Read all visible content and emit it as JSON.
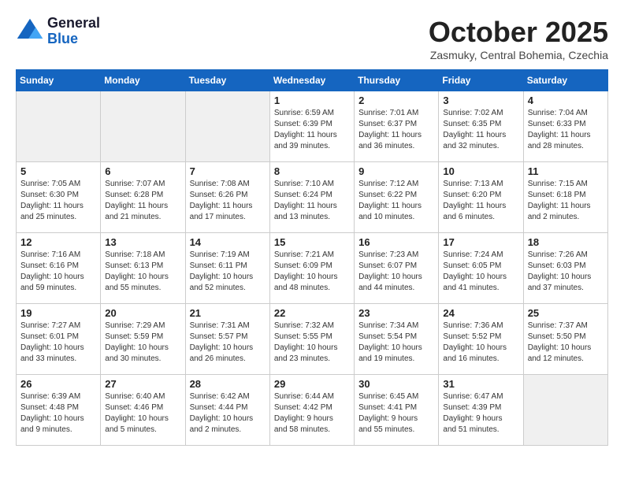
{
  "header": {
    "logo_line1": "General",
    "logo_line2": "Blue",
    "month": "October 2025",
    "location": "Zasmuky, Central Bohemia, Czechia"
  },
  "days_of_week": [
    "Sunday",
    "Monday",
    "Tuesday",
    "Wednesday",
    "Thursday",
    "Friday",
    "Saturday"
  ],
  "weeks": [
    [
      {
        "day": null,
        "text": null
      },
      {
        "day": null,
        "text": null
      },
      {
        "day": null,
        "text": null
      },
      {
        "day": "1",
        "text": "Sunrise: 6:59 AM\nSunset: 6:39 PM\nDaylight: 11 hours\nand 39 minutes."
      },
      {
        "day": "2",
        "text": "Sunrise: 7:01 AM\nSunset: 6:37 PM\nDaylight: 11 hours\nand 36 minutes."
      },
      {
        "day": "3",
        "text": "Sunrise: 7:02 AM\nSunset: 6:35 PM\nDaylight: 11 hours\nand 32 minutes."
      },
      {
        "day": "4",
        "text": "Sunrise: 7:04 AM\nSunset: 6:33 PM\nDaylight: 11 hours\nand 28 minutes."
      }
    ],
    [
      {
        "day": "5",
        "text": "Sunrise: 7:05 AM\nSunset: 6:30 PM\nDaylight: 11 hours\nand 25 minutes."
      },
      {
        "day": "6",
        "text": "Sunrise: 7:07 AM\nSunset: 6:28 PM\nDaylight: 11 hours\nand 21 minutes."
      },
      {
        "day": "7",
        "text": "Sunrise: 7:08 AM\nSunset: 6:26 PM\nDaylight: 11 hours\nand 17 minutes."
      },
      {
        "day": "8",
        "text": "Sunrise: 7:10 AM\nSunset: 6:24 PM\nDaylight: 11 hours\nand 13 minutes."
      },
      {
        "day": "9",
        "text": "Sunrise: 7:12 AM\nSunset: 6:22 PM\nDaylight: 11 hours\nand 10 minutes."
      },
      {
        "day": "10",
        "text": "Sunrise: 7:13 AM\nSunset: 6:20 PM\nDaylight: 11 hours\nand 6 minutes."
      },
      {
        "day": "11",
        "text": "Sunrise: 7:15 AM\nSunset: 6:18 PM\nDaylight: 11 hours\nand 2 minutes."
      }
    ],
    [
      {
        "day": "12",
        "text": "Sunrise: 7:16 AM\nSunset: 6:16 PM\nDaylight: 10 hours\nand 59 minutes."
      },
      {
        "day": "13",
        "text": "Sunrise: 7:18 AM\nSunset: 6:13 PM\nDaylight: 10 hours\nand 55 minutes."
      },
      {
        "day": "14",
        "text": "Sunrise: 7:19 AM\nSunset: 6:11 PM\nDaylight: 10 hours\nand 52 minutes."
      },
      {
        "day": "15",
        "text": "Sunrise: 7:21 AM\nSunset: 6:09 PM\nDaylight: 10 hours\nand 48 minutes."
      },
      {
        "day": "16",
        "text": "Sunrise: 7:23 AM\nSunset: 6:07 PM\nDaylight: 10 hours\nand 44 minutes."
      },
      {
        "day": "17",
        "text": "Sunrise: 7:24 AM\nSunset: 6:05 PM\nDaylight: 10 hours\nand 41 minutes."
      },
      {
        "day": "18",
        "text": "Sunrise: 7:26 AM\nSunset: 6:03 PM\nDaylight: 10 hours\nand 37 minutes."
      }
    ],
    [
      {
        "day": "19",
        "text": "Sunrise: 7:27 AM\nSunset: 6:01 PM\nDaylight: 10 hours\nand 33 minutes."
      },
      {
        "day": "20",
        "text": "Sunrise: 7:29 AM\nSunset: 5:59 PM\nDaylight: 10 hours\nand 30 minutes."
      },
      {
        "day": "21",
        "text": "Sunrise: 7:31 AM\nSunset: 5:57 PM\nDaylight: 10 hours\nand 26 minutes."
      },
      {
        "day": "22",
        "text": "Sunrise: 7:32 AM\nSunset: 5:55 PM\nDaylight: 10 hours\nand 23 minutes."
      },
      {
        "day": "23",
        "text": "Sunrise: 7:34 AM\nSunset: 5:54 PM\nDaylight: 10 hours\nand 19 minutes."
      },
      {
        "day": "24",
        "text": "Sunrise: 7:36 AM\nSunset: 5:52 PM\nDaylight: 10 hours\nand 16 minutes."
      },
      {
        "day": "25",
        "text": "Sunrise: 7:37 AM\nSunset: 5:50 PM\nDaylight: 10 hours\nand 12 minutes."
      }
    ],
    [
      {
        "day": "26",
        "text": "Sunrise: 6:39 AM\nSunset: 4:48 PM\nDaylight: 10 hours\nand 9 minutes."
      },
      {
        "day": "27",
        "text": "Sunrise: 6:40 AM\nSunset: 4:46 PM\nDaylight: 10 hours\nand 5 minutes."
      },
      {
        "day": "28",
        "text": "Sunrise: 6:42 AM\nSunset: 4:44 PM\nDaylight: 10 hours\nand 2 minutes."
      },
      {
        "day": "29",
        "text": "Sunrise: 6:44 AM\nSunset: 4:42 PM\nDaylight: 9 hours\nand 58 minutes."
      },
      {
        "day": "30",
        "text": "Sunrise: 6:45 AM\nSunset: 4:41 PM\nDaylight: 9 hours\nand 55 minutes."
      },
      {
        "day": "31",
        "text": "Sunrise: 6:47 AM\nSunset: 4:39 PM\nDaylight: 9 hours\nand 51 minutes."
      },
      {
        "day": null,
        "text": null
      }
    ]
  ]
}
